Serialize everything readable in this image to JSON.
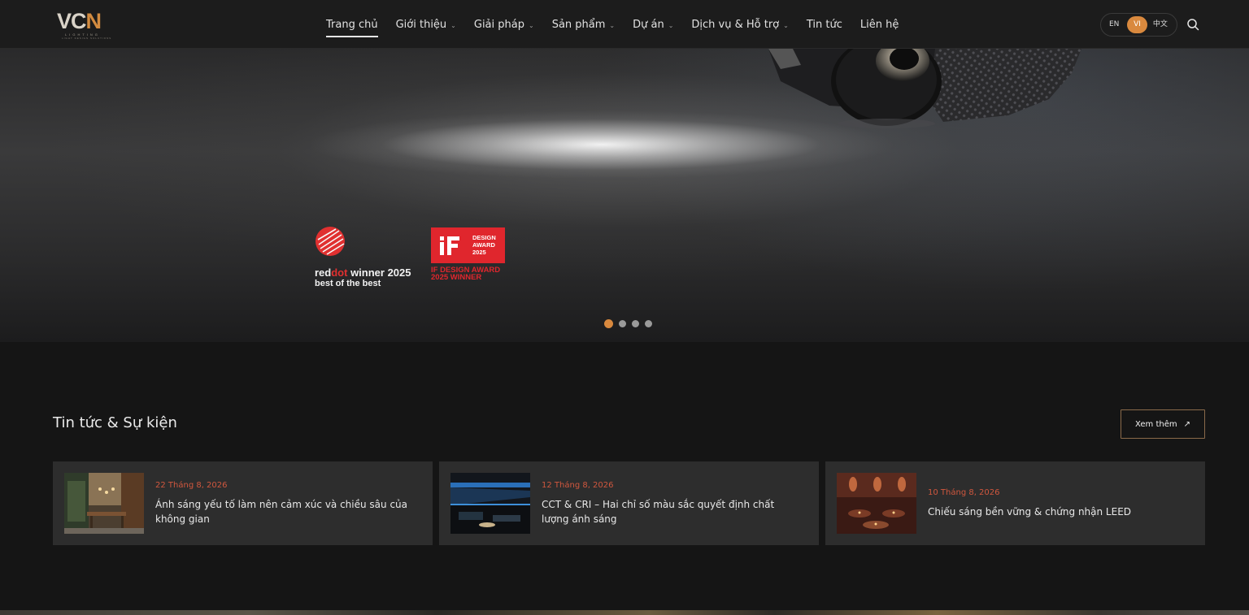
{
  "header": {
    "logo": {
      "text": "VCN",
      "sub": "LIGHTING",
      "tagline": "LIGHT DESIGN SOLUTIONS"
    },
    "nav": [
      {
        "label": "Trang chủ",
        "active": true,
        "has_dropdown": false
      },
      {
        "label": "Giới thiệu",
        "active": false,
        "has_dropdown": true
      },
      {
        "label": "Giải pháp",
        "active": false,
        "has_dropdown": true
      },
      {
        "label": "Sản phẩm",
        "active": false,
        "has_dropdown": true
      },
      {
        "label": "Dự án",
        "active": false,
        "has_dropdown": true
      },
      {
        "label": "Dịch vụ & Hỗ trợ",
        "active": false,
        "has_dropdown": true
      },
      {
        "label": "Tin tức",
        "active": false,
        "has_dropdown": false
      },
      {
        "label": "Liên hệ",
        "active": false,
        "has_dropdown": false
      }
    ],
    "languages": [
      {
        "code": "EN",
        "active": false
      },
      {
        "code": "VI",
        "active": true
      },
      {
        "code": "中文",
        "active": false
      }
    ],
    "search_icon": "search-icon"
  },
  "hero": {
    "reddot": {
      "line1_a": "red",
      "line1_b": "dot",
      "line1_c": " winner 2025",
      "line2": "best of the best"
    },
    "if_award": {
      "mark": "iF",
      "text": [
        "DESIGN",
        "AWARD",
        "2025"
      ],
      "caption_1": "IF DESIGN AWARD",
      "caption_2": "2025 WINNER"
    },
    "slides": {
      "count": 4,
      "active": 0
    }
  },
  "news": {
    "title": "Tin tức & Sự kiện",
    "more_label": "Xem thêm",
    "more_icon": "arrow-up-right-icon",
    "items": [
      {
        "date": "22 Tháng 8, 2026",
        "title": "Ánh sáng yếu tố làm nên cảm xúc và chiều sâu của không gian"
      },
      {
        "date": "12 Tháng 8, 2026",
        "title": "CCT & CRI – Hai chỉ số màu sắc quyết định chất lượng ánh sáng"
      },
      {
        "date": "10 Tháng 8, 2026",
        "title": "Chiếu sáng bền vững & chứng nhận LEED"
      }
    ]
  },
  "colors": {
    "accent": "#d9893e",
    "date": "#d0573e",
    "reddot": "#e03030",
    "if_red": "#e0262d",
    "background": "#151515",
    "card": "#2d2d2d"
  }
}
